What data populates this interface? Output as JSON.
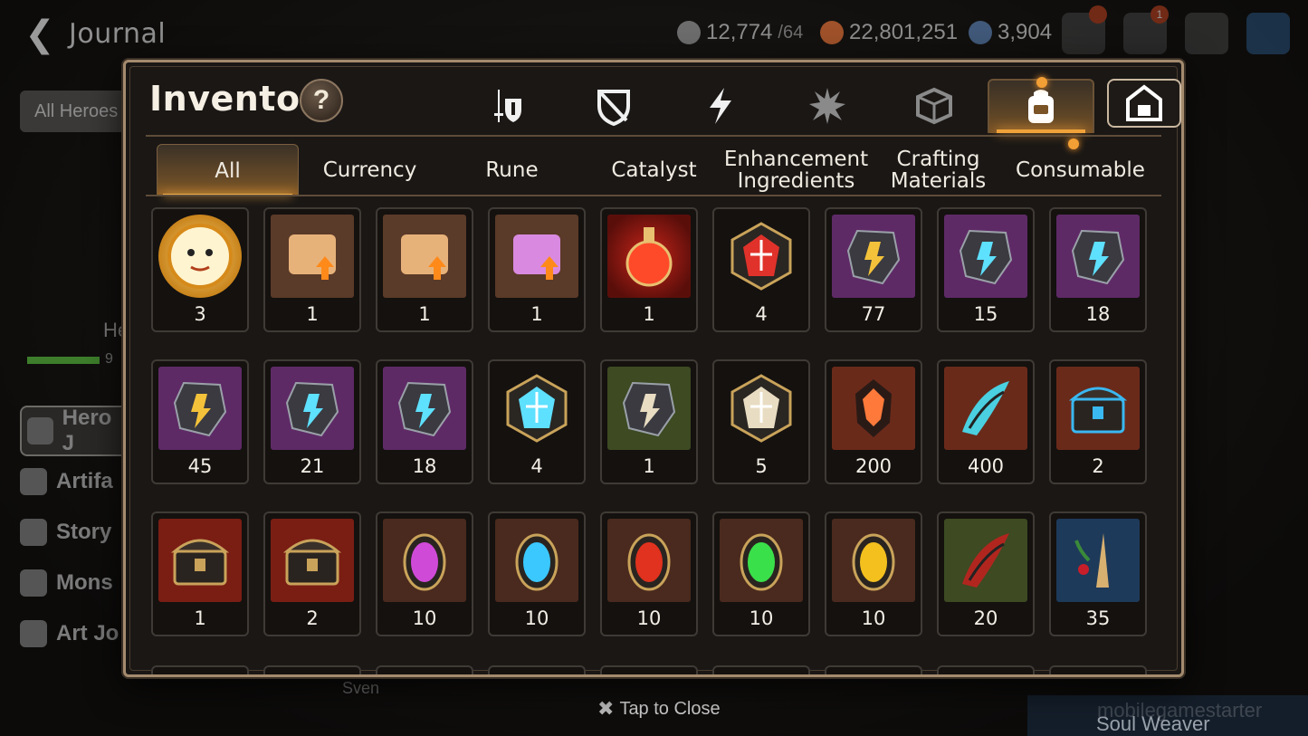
{
  "journal": {
    "title": "Journal",
    "resources": [
      {
        "icon": "stamina-icon",
        "value": "12,774",
        "cap": "/64",
        "color": "#9a9a9a"
      },
      {
        "icon": "gold-icon",
        "value": "22,801,251",
        "cap": "",
        "color": "#c0602a"
      },
      {
        "icon": "skystone-icon",
        "value": "3,904",
        "cap": "",
        "color": "#5a7aa0"
      }
    ],
    "mail_badge": "1",
    "filter": "All Heroes",
    "hero_label": "Hero",
    "hero_value": "9",
    "side_menu": [
      "Hero J",
      "Artifa",
      "Story",
      "Mons",
      "Art Jo"
    ],
    "bottom_name": "Sven",
    "soul_weaver": "Soul Weaver",
    "watermark": "mobilegamestarter"
  },
  "inventory": {
    "title": "Inventory",
    "help": "?",
    "category_tabs": [
      {
        "icon": "equipment-icon"
      },
      {
        "icon": "broken-shield-icon"
      },
      {
        "icon": "artifact-bolt-icon"
      },
      {
        "icon": "explosion-icon"
      },
      {
        "icon": "crafted-cube-icon"
      },
      {
        "icon": "bag-icon",
        "active": true
      },
      {
        "icon": "storage-house-icon"
      }
    ],
    "filter_tabs": [
      "All",
      "Currency",
      "Rune",
      "Catalyst",
      "Enhancement Ingredients",
      "Crafting Materials",
      "Consumable"
    ],
    "active_filter": "All",
    "items": [
      {
        "icon": "yellow-cat-coin-icon",
        "qty": "3"
      },
      {
        "icon": "scroll-upgrade-icon",
        "qty": "1"
      },
      {
        "icon": "scroll-upgrade-icon",
        "qty": "1"
      },
      {
        "icon": "rainbow-scroll-upgrade-icon",
        "qty": "1"
      },
      {
        "icon": "red-potion-icon",
        "qty": "1"
      },
      {
        "icon": "red-rune-hex-icon",
        "qty": "4"
      },
      {
        "icon": "hammer-stone-icon",
        "qty": "77"
      },
      {
        "icon": "boot-stone-icon",
        "qty": "15"
      },
      {
        "icon": "sword-stone-icon",
        "qty": "18"
      },
      {
        "icon": "bolt-stone-icon",
        "qty": "45"
      },
      {
        "icon": "ring-stone-icon",
        "qty": "21"
      },
      {
        "icon": "helmet-stone-icon",
        "qty": "18"
      },
      {
        "icon": "purple-rune-hex-icon",
        "qty": "4"
      },
      {
        "icon": "white-sword-stone-icon",
        "qty": "1"
      },
      {
        "icon": "green-rune-hex-icon",
        "qty": "5"
      },
      {
        "icon": "red-ore-icon",
        "qty": "200"
      },
      {
        "icon": "blue-claw-icon",
        "qty": "400"
      },
      {
        "icon": "blue-chest-icon",
        "qty": "2"
      },
      {
        "icon": "dark-chest-icon",
        "qty": "1"
      },
      {
        "icon": "dark-chest-icon",
        "qty": "2"
      },
      {
        "icon": "purple-gem-icon",
        "qty": "10"
      },
      {
        "icon": "cyan-gem-icon",
        "qty": "10"
      },
      {
        "icon": "red-gem-icon",
        "qty": "10"
      },
      {
        "icon": "green-gem-icon",
        "qty": "10"
      },
      {
        "icon": "yellow-gem-icon",
        "qty": "10"
      },
      {
        "icon": "red-talon-icon",
        "qty": "20"
      },
      {
        "icon": "herb-root-icon",
        "qty": "35"
      }
    ]
  },
  "close_hint": "Tap to Close"
}
